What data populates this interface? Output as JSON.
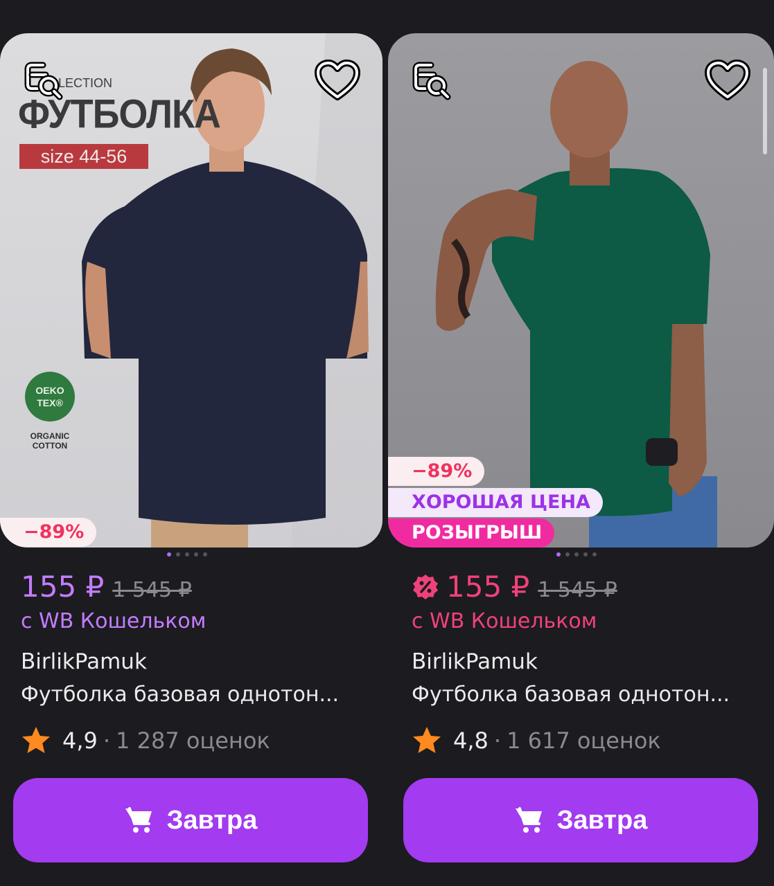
{
  "products": [
    {
      "poster": {
        "collection": "LECTION",
        "title": "ФУТБОЛКА",
        "size": "size 44-56",
        "oeko": "OEKO\nTEX®",
        "organic": "ORGANIC\nCOTTON"
      },
      "badges": {
        "discount": "−89%"
      },
      "price": "155 ₽",
      "old_price": "1 545 ₽",
      "wallet": "с WB Кошельком",
      "brand": "BirlikPamuk",
      "name": "Футболка базовая однотон...",
      "rating": "4,9",
      "rating_sep": "·",
      "reviews": "1 287 оценок",
      "button_label": "Завтра",
      "image_dots": 5
    },
    {
      "badges": {
        "discount": "−89%",
        "good_price": "ХОРОШАЯ ЦЕНА",
        "raffle": "РОЗЫГРЫШ"
      },
      "price": "155 ₽",
      "old_price": "1 545 ₽",
      "wallet": "с WB Кошельком",
      "brand": "BirlikPamuk",
      "name": "Футболка базовая однотон...",
      "rating": "4,8",
      "rating_sep": "·",
      "reviews": "1 617 оценок",
      "button_label": "Завтра",
      "image_dots": 5
    }
  ],
  "colors": {
    "background": "#1c1b20",
    "accent_purple": "#a33bf1",
    "price_purple": "#c37dff",
    "price_pink": "#f0427a",
    "star": "#ff8a1f",
    "shirt_navy": "#23273d",
    "shirt_green": "#0d5a45"
  },
  "icons": [
    "find-similar-icon",
    "heart-icon",
    "sale-percent-icon",
    "star-icon",
    "cart-icon"
  ]
}
